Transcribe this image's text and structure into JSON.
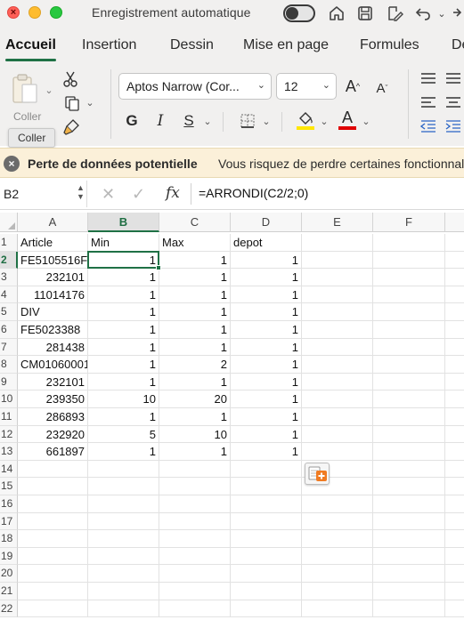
{
  "window": {
    "title": "Enregistrement automatique",
    "autosave_on": false,
    "traffic_colors": {
      "close": "#ff5f57",
      "minimize": "#febc2e",
      "maximize": "#28c840"
    }
  },
  "ribbon": {
    "tabs": [
      {
        "label": "Accueil",
        "active": true
      },
      {
        "label": "Insertion",
        "active": false
      },
      {
        "label": "Dessin",
        "active": false
      },
      {
        "label": "Mise en page",
        "active": false
      },
      {
        "label": "Formules",
        "active": false
      },
      {
        "label": "De",
        "active": false
      }
    ],
    "paste_label": "Coller",
    "tooltip": "Coller",
    "font_name": "Aptos Narrow (Cor...",
    "font_size": "12",
    "bold_label": "G",
    "italic_label": "I",
    "underline_label": "S",
    "grow_font_label": "A",
    "shrink_font_label": "A",
    "font_color_label": "A",
    "highlight_color": "#ffe600",
    "font_color": "#e00000",
    "accent": "#1f7145"
  },
  "warning": {
    "title": "Perte de données potentielle",
    "message": "Vous risquez de perdre certaines fonctionnalités"
  },
  "formula_bar": {
    "name_box": "B2",
    "fx_label": "fx",
    "formula": "=ARRONDI(C2/2;0)"
  },
  "sheet": {
    "columns": [
      "A",
      "B",
      "C",
      "D",
      "E",
      "F"
    ],
    "selected_column": "B",
    "selected_row": 2,
    "row_numbers": [
      "1",
      "2",
      "3",
      "4",
      "5",
      "6",
      "7",
      "8",
      "9",
      "10",
      "11",
      "12",
      "13",
      "14",
      "15",
      "16",
      "17",
      "18",
      "19",
      "20",
      "21",
      "22"
    ],
    "rows": [
      [
        {
          "v": "Article",
          "t": "txt"
        },
        {
          "v": "Min",
          "t": "txt"
        },
        {
          "v": "Max",
          "t": "txt"
        },
        {
          "v": "depot",
          "t": "txt"
        },
        {
          "v": "",
          "t": "txt"
        },
        {
          "v": "",
          "t": "txt"
        }
      ],
      [
        {
          "v": "FE5105516F",
          "t": "txt"
        },
        {
          "v": "1",
          "t": "num"
        },
        {
          "v": "1",
          "t": "num"
        },
        {
          "v": "1",
          "t": "num"
        },
        {
          "v": "",
          "t": "txt"
        },
        {
          "v": "",
          "t": "txt"
        }
      ],
      [
        {
          "v": "232101",
          "t": "num"
        },
        {
          "v": "1",
          "t": "num"
        },
        {
          "v": "1",
          "t": "num"
        },
        {
          "v": "1",
          "t": "num"
        },
        {
          "v": "",
          "t": "txt"
        },
        {
          "v": "",
          "t": "txt"
        }
      ],
      [
        {
          "v": "11014176",
          "t": "num"
        },
        {
          "v": "1",
          "t": "num"
        },
        {
          "v": "1",
          "t": "num"
        },
        {
          "v": "1",
          "t": "num"
        },
        {
          "v": "",
          "t": "txt"
        },
        {
          "v": "",
          "t": "txt"
        }
      ],
      [
        {
          "v": "DIV",
          "t": "txt"
        },
        {
          "v": "1",
          "t": "num"
        },
        {
          "v": "1",
          "t": "num"
        },
        {
          "v": "1",
          "t": "num"
        },
        {
          "v": "",
          "t": "txt"
        },
        {
          "v": "",
          "t": "txt"
        }
      ],
      [
        {
          "v": "FE5023388",
          "t": "txt"
        },
        {
          "v": "1",
          "t": "num"
        },
        {
          "v": "1",
          "t": "num"
        },
        {
          "v": "1",
          "t": "num"
        },
        {
          "v": "",
          "t": "txt"
        },
        {
          "v": "",
          "t": "txt"
        }
      ],
      [
        {
          "v": "281438",
          "t": "num"
        },
        {
          "v": "1",
          "t": "num"
        },
        {
          "v": "1",
          "t": "num"
        },
        {
          "v": "1",
          "t": "num"
        },
        {
          "v": "",
          "t": "txt"
        },
        {
          "v": "",
          "t": "txt"
        }
      ],
      [
        {
          "v": "CM01060001",
          "t": "txt"
        },
        {
          "v": "1",
          "t": "num"
        },
        {
          "v": "2",
          "t": "num"
        },
        {
          "v": "1",
          "t": "num"
        },
        {
          "v": "",
          "t": "txt"
        },
        {
          "v": "",
          "t": "txt"
        }
      ],
      [
        {
          "v": "232101",
          "t": "num"
        },
        {
          "v": "1",
          "t": "num"
        },
        {
          "v": "1",
          "t": "num"
        },
        {
          "v": "1",
          "t": "num"
        },
        {
          "v": "",
          "t": "txt"
        },
        {
          "v": "",
          "t": "txt"
        }
      ],
      [
        {
          "v": "239350",
          "t": "num"
        },
        {
          "v": "10",
          "t": "num"
        },
        {
          "v": "20",
          "t": "num"
        },
        {
          "v": "1",
          "t": "num"
        },
        {
          "v": "",
          "t": "txt"
        },
        {
          "v": "",
          "t": "txt"
        }
      ],
      [
        {
          "v": "286893",
          "t": "num"
        },
        {
          "v": "1",
          "t": "num"
        },
        {
          "v": "1",
          "t": "num"
        },
        {
          "v": "1",
          "t": "num"
        },
        {
          "v": "",
          "t": "txt"
        },
        {
          "v": "",
          "t": "txt"
        }
      ],
      [
        {
          "v": "232920",
          "t": "num"
        },
        {
          "v": "5",
          "t": "num"
        },
        {
          "v": "10",
          "t": "num"
        },
        {
          "v": "1",
          "t": "num"
        },
        {
          "v": "",
          "t": "txt"
        },
        {
          "v": "",
          "t": "txt"
        }
      ],
      [
        {
          "v": "661897",
          "t": "num"
        },
        {
          "v": "1",
          "t": "num"
        },
        {
          "v": "1",
          "t": "num"
        },
        {
          "v": "1",
          "t": "num"
        },
        {
          "v": "",
          "t": "txt"
        },
        {
          "v": "",
          "t": "txt"
        }
      ]
    ]
  }
}
